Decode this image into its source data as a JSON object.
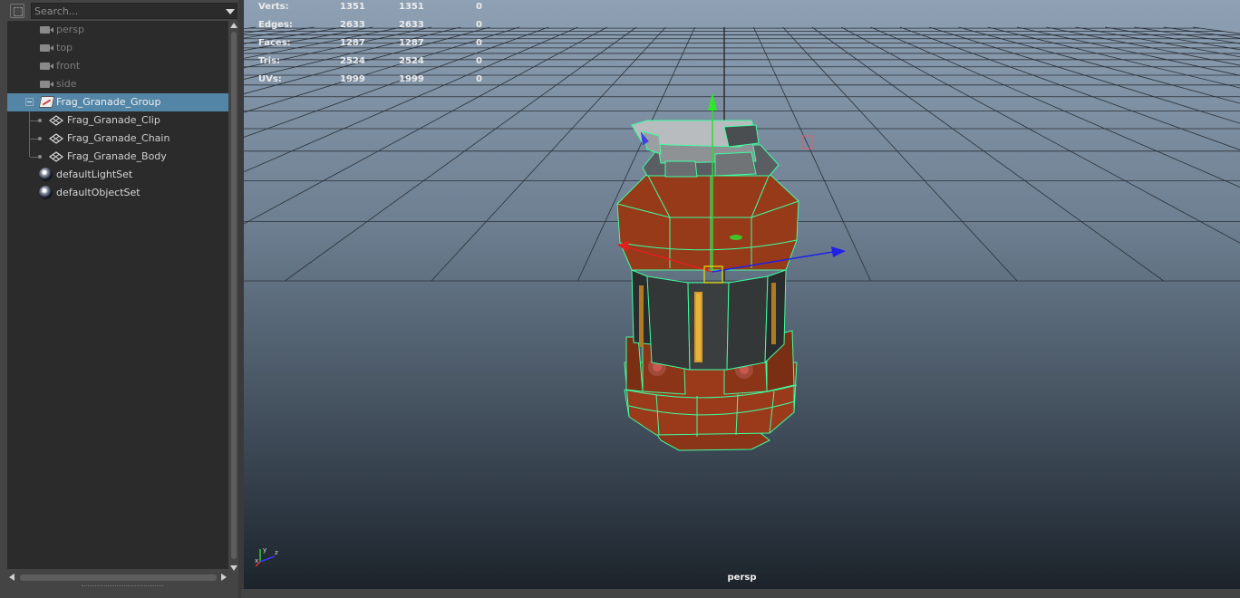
{
  "outliner": {
    "search": {
      "placeholder": "Search..."
    },
    "items": [
      {
        "label": "persp",
        "kind": "camera"
      },
      {
        "label": "top",
        "kind": "camera"
      },
      {
        "label": "front",
        "kind": "camera"
      },
      {
        "label": "side",
        "kind": "camera"
      },
      {
        "label": "Frag_Granade_Group",
        "kind": "group",
        "selected": true,
        "expanded": true
      },
      {
        "label": "Frag_Granade_Clip",
        "kind": "mesh"
      },
      {
        "label": "Frag_Granade_Chain",
        "kind": "mesh"
      },
      {
        "label": "Frag_Granade_Body",
        "kind": "mesh"
      },
      {
        "label": "defaultLightSet",
        "kind": "set"
      },
      {
        "label": "defaultObjectSet",
        "kind": "set"
      }
    ],
    "colors": {
      "selection": "#5285a6",
      "panel": "#2b2b2b"
    }
  },
  "viewport": {
    "camera": "persp",
    "hud": [
      {
        "label": "Verts:",
        "v1": "1351",
        "v2": "1351",
        "v3": "0"
      },
      {
        "label": "Edges:",
        "v1": "2633",
        "v2": "2633",
        "v3": "0"
      },
      {
        "label": "Faces:",
        "v1": "1287",
        "v2": "1287",
        "v3": "0"
      },
      {
        "label": "Tris:",
        "v1": "2524",
        "v2": "2524",
        "v3": "0"
      },
      {
        "label": "UVs:",
        "v1": "1999",
        "v2": "1999",
        "v3": "0"
      }
    ],
    "model": "frag-grenade-mesh",
    "wireframe_color": "#3dffa0",
    "axis_indicator": {
      "x": "x",
      "y": "y",
      "z": "z"
    }
  }
}
